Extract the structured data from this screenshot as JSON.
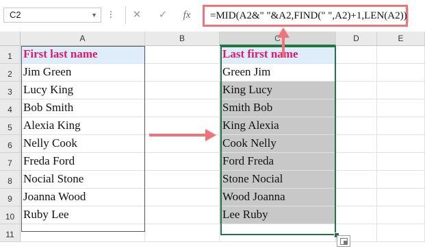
{
  "name_box": {
    "value": "C2"
  },
  "formula_bar": {
    "cancel_icon": "close-icon",
    "enter_icon": "check-icon",
    "fx_label": "fx",
    "formula": "=MID(A2&\" \"&A2,FIND(\" \",A2)+1,LEN(A2))"
  },
  "columns": [
    "A",
    "B",
    "C",
    "D",
    "E"
  ],
  "rows": [
    "1",
    "2",
    "3",
    "4",
    "5",
    "6",
    "7",
    "8",
    "9",
    "10",
    "11"
  ],
  "column_a": {
    "header": "First last name",
    "values": [
      "Jim Green",
      "Lucy King",
      "Bob Smith",
      "Alexia King",
      "Nelly Cook",
      "Freda Ford",
      "Nocial Stone",
      "Joanna Wood",
      "Ruby Lee"
    ]
  },
  "column_c": {
    "header": "Last first name",
    "values": [
      "Green Jim",
      "King Lucy",
      "Smith Bob",
      "King Alexia",
      "Cook Nelly",
      "Ford Freda",
      "Stone Nocial",
      "Wood Joanna",
      "Lee Ruby"
    ]
  },
  "colors": {
    "header_text": "#e0196e",
    "header_fill": "#ddeefa",
    "selection_border": "#217346",
    "arrow": "#f0737a",
    "shaded_fill": "#c8c8c8"
  }
}
